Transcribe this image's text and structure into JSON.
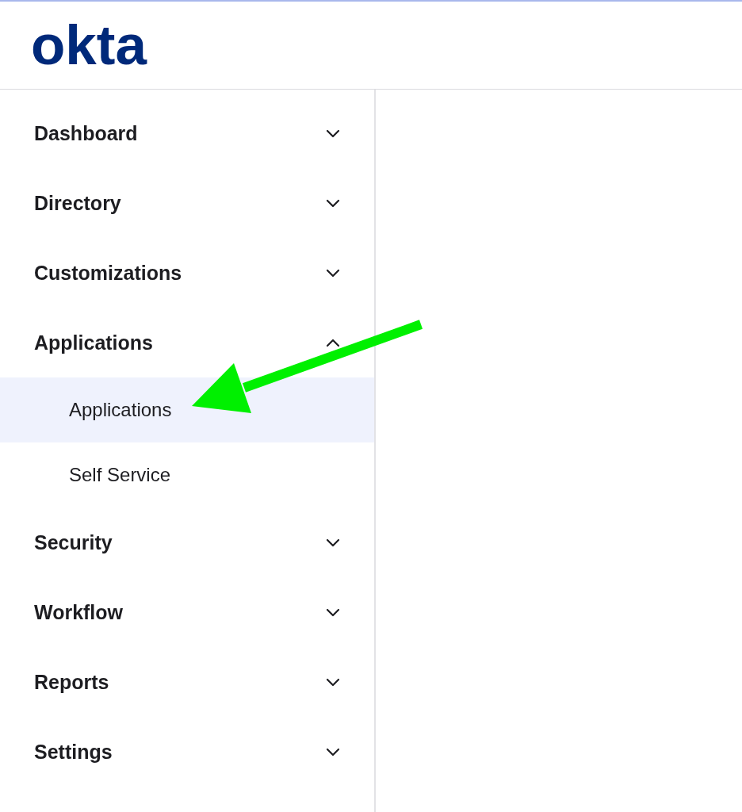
{
  "header": {
    "logo": "okta"
  },
  "sidebar": {
    "items": [
      {
        "label": "Dashboard",
        "expanded": false
      },
      {
        "label": "Directory",
        "expanded": false
      },
      {
        "label": "Customizations",
        "expanded": false
      },
      {
        "label": "Applications",
        "expanded": true,
        "children": [
          {
            "label": "Applications",
            "selected": true
          },
          {
            "label": "Self Service",
            "selected": false
          }
        ]
      },
      {
        "label": "Security",
        "expanded": false
      },
      {
        "label": "Workflow",
        "expanded": false
      },
      {
        "label": "Reports",
        "expanded": false
      },
      {
        "label": "Settings",
        "expanded": false
      }
    ]
  },
  "annotations": [
    {
      "kind": "arrow"
    }
  ]
}
